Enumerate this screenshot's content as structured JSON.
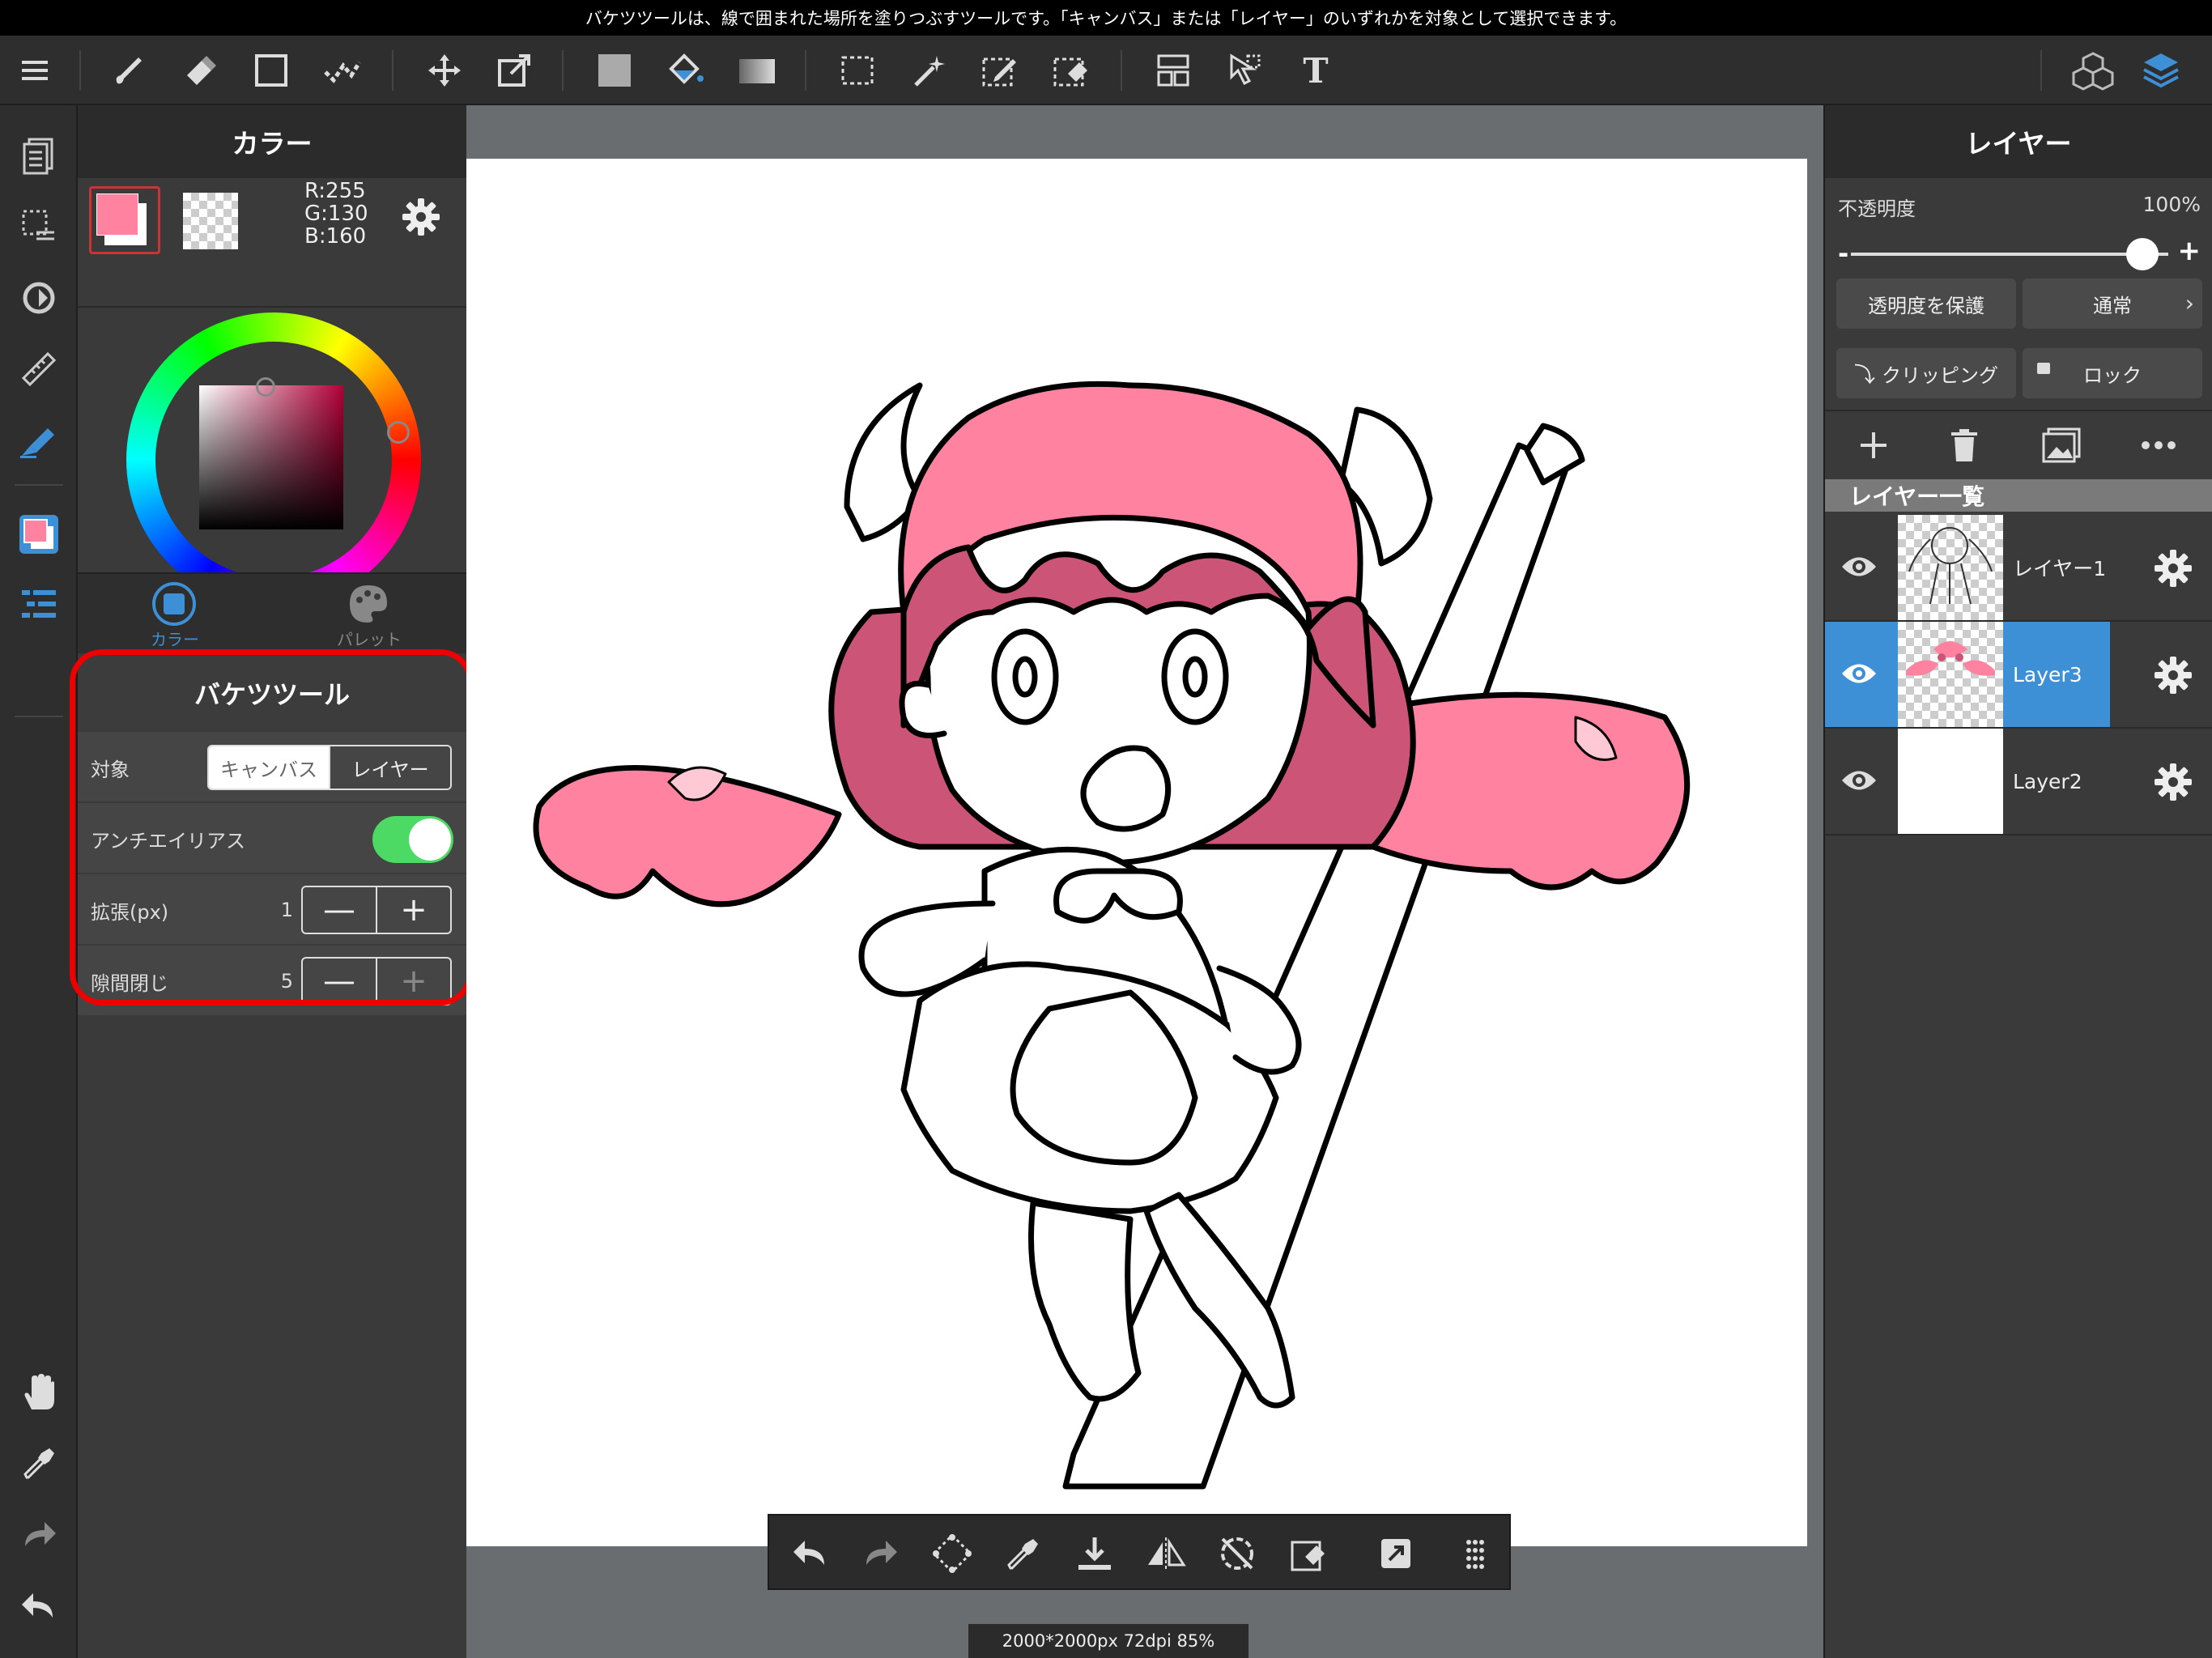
{
  "hint_bar": {
    "text": "バケツツールは、線で囲まれた場所を塗りつぶすツールです。「キャンバス」または「レイヤー」のいずれかを対象として選択できます。"
  },
  "toolbar": {
    "tools": [
      "menu-icon",
      "brush-icon",
      "eraser-icon",
      "rectangle-icon",
      "dot-icon",
      "move-icon",
      "transform-icon",
      "fill-color-icon",
      "bucket-icon",
      "gradient-icon",
      "select-icon",
      "magic-wand-icon",
      "select-pen-icon",
      "select-eraser-icon",
      "divide-icon",
      "operation-icon",
      "text-icon",
      "3d-icon",
      "layers-icon"
    ],
    "text_tool_glyph": "T"
  },
  "rail": {
    "items": [
      "page-icon",
      "selection-icon",
      "rotate-icon",
      "ruler-icon",
      "edit-icon",
      "color-icon",
      "layer-list-icon",
      "hand-icon",
      "eyedropper-icon",
      "redo-icon",
      "undo-icon"
    ]
  },
  "color_panel": {
    "title": "カラー",
    "primary_color": "#ff82a0",
    "rgb": {
      "r": "R:255",
      "g": "G:130",
      "b": "B:160"
    },
    "tabs": [
      {
        "label": "カラー",
        "active": true,
        "icon": "color-circle-icon"
      },
      {
        "label": "パレット",
        "active": false,
        "icon": "palette-icon"
      }
    ]
  },
  "bucket_panel": {
    "title": "バケツツール",
    "target_label": "対象",
    "target_options": [
      "キャンバス",
      "レイヤー"
    ],
    "target_selected": "キャンバス",
    "antialias_label": "アンチエイリアス",
    "antialias_on": true,
    "expand_label": "拡張(px)",
    "expand_value": "1",
    "gap_label": "隙間閉じ",
    "gap_value": "5",
    "minus": "—",
    "plus": "+"
  },
  "canvas": {
    "status": "2000*2000px 72dpi 85%"
  },
  "quickbar": {
    "items": [
      "undo-icon",
      "redo-icon",
      "transform-icon",
      "eyedropper-icon",
      "save-icon",
      "flip-icon",
      "rotate-reset-icon",
      "eraser-select-icon",
      "share-icon",
      "grip-icon"
    ]
  },
  "layer_panel": {
    "title": "レイヤー",
    "opacity_label": "不透明度",
    "opacity_value": "100%",
    "opacity_level": 1.0,
    "minus": "-",
    "plus": "+",
    "protect_alpha": "透明度を保護",
    "blend_mode": "通常",
    "clipping": "クリッピング",
    "lock": "ロック",
    "list_title": "レイヤー一覧",
    "layers": [
      {
        "name": "レイヤー1",
        "selected": false
      },
      {
        "name": "Layer3",
        "selected": true
      },
      {
        "name": "Layer2",
        "selected": false
      }
    ]
  },
  "colors": {
    "accent": "#3d8fd6",
    "pink": "#ff82a0",
    "dark_pink": "#cc5577",
    "toggle_green": "#4cd964",
    "highlight_red": "#e00000"
  }
}
